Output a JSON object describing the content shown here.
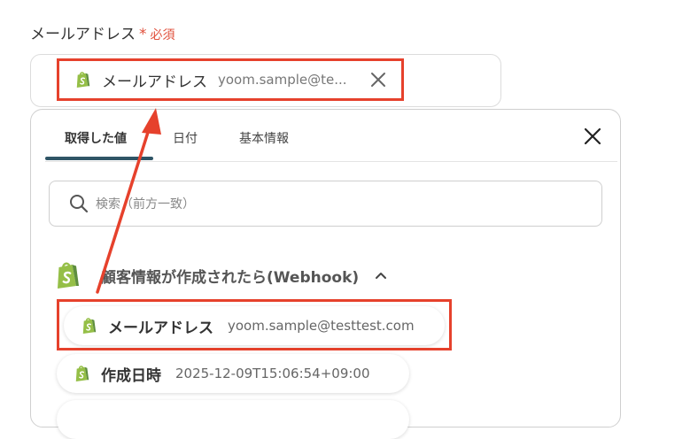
{
  "field": {
    "label": "メールアドレス",
    "required_mark": "*",
    "required_text": "必須",
    "chip": {
      "icon": "shopify-icon",
      "label": "メールアドレス",
      "value": "yoom.sample@te..."
    }
  },
  "panel": {
    "tabs": [
      {
        "label": "取得した値",
        "active": true
      },
      {
        "label": "日付",
        "active": false
      },
      {
        "label": "基本情報",
        "active": false
      }
    ],
    "search": {
      "placeholder": "検索（前方一致）"
    },
    "group": {
      "title": "顧客情報が作成されたら(Webhook)",
      "icon": "shopify-icon",
      "expanded": true
    },
    "items": [
      {
        "label": "メールアドレス",
        "value": "yoom.sample@testtest.com"
      },
      {
        "label": "作成日時",
        "value": "2025-12-09T15:06:54+09:00"
      }
    ]
  },
  "colors": {
    "highlight": "#e6412c",
    "tab_underline": "#2f5566",
    "required": "#e0503c",
    "shopify_green": "#95bf47"
  }
}
